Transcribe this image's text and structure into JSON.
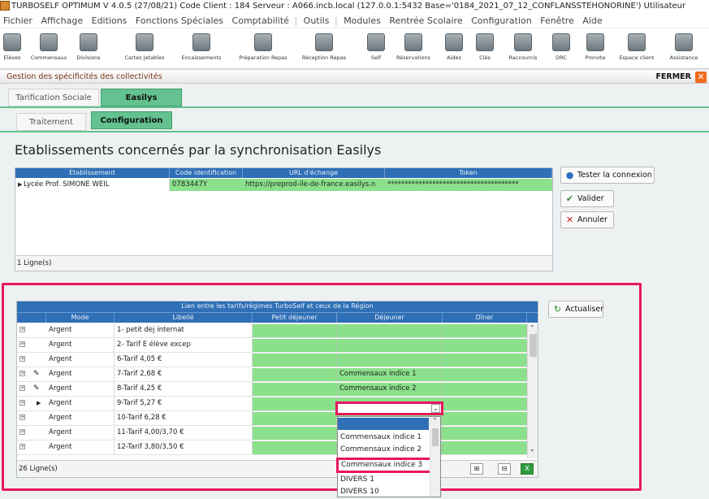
{
  "app": {
    "title": "TURBOSELF OPTIMUM  V 4.0.5 (27/08/21)  Code Client : 184  Serveur : A066.incb.local (127.0.0.1:5432 Base='0184_2021_07_12_CONFLANSSTEHONORINE')  Utilisateur"
  },
  "menu": [
    "Fichier",
    "Affichage",
    "Editions",
    "Fonctions Spéciales",
    "Comptabilité",
    "Outils",
    "Modules",
    "Rentrée Scolaire",
    "Configuration",
    "Fenêtre",
    "Aide"
  ],
  "toolbar": [
    {
      "label": "Elèves",
      "icon": "students-icon"
    },
    {
      "label": "Commensaux",
      "icon": "diners-icon"
    },
    {
      "label": "Divisions",
      "icon": "divisions-icon"
    },
    {
      "label": "Cartes Jetables",
      "icon": "cards-icon"
    },
    {
      "label": "Encaissements",
      "icon": "cashier-icon"
    },
    {
      "label": "Préparation Repas",
      "icon": "meal-prep-icon"
    },
    {
      "label": "Réception Repas",
      "icon": "meal-reception-icon"
    },
    {
      "label": "Self",
      "icon": "self-icon"
    },
    {
      "label": "Réservations",
      "icon": "reservations-icon"
    },
    {
      "label": "Aides",
      "icon": "aides-icon"
    },
    {
      "label": "Clés",
      "icon": "keys-icon"
    },
    {
      "label": "Raccourcis",
      "icon": "shortcuts-icon"
    },
    {
      "label": "DRC",
      "icon": "drc-icon"
    },
    {
      "label": "Pronote",
      "icon": "pronote-icon"
    },
    {
      "label": "Espace client",
      "icon": "client-space-icon"
    },
    {
      "label": "Assistance",
      "icon": "assistance-icon"
    }
  ],
  "window": {
    "title": "Gestion des spécificités des collectivités",
    "close_label": "FERMER",
    "tabs": [
      "Tarification Sociale",
      "Easilys"
    ],
    "subtabs": [
      "Traitement",
      "Configuration"
    ],
    "heading": "Etablissements concernés par la synchronisation Easilys"
  },
  "etab_grid": {
    "columns": [
      "Etablissement",
      "Code identification",
      "URL d'échange",
      "Token"
    ],
    "rows": [
      [
        "Lycée Prof. SIMONE WEIL",
        "0783447Y",
        "https://preprod-ile-de-france.easilys.n",
        "**************************************"
      ]
    ],
    "count": "1 Ligne(s)"
  },
  "side_buttons": {
    "test": "Tester la connexion",
    "validate": "Valider",
    "cancel": "Annuler",
    "refresh": "Actualiser"
  },
  "tarif_grid": {
    "title": "Lien entre les tarifs/régimes TurboSelf et ceux de la Région",
    "columns": [
      "Mode",
      "Libellé",
      "Petit déjeuner",
      "Déjeuner",
      "Dîner"
    ],
    "rows": [
      {
        "mode": "Argent",
        "label": "1- petit dej internat",
        "dej": ""
      },
      {
        "mode": "Argent",
        "label": "2- Tarif E élève excep",
        "dej": ""
      },
      {
        "mode": "Argent",
        "label": "6-Tarif 4,05 €",
        "dej": ""
      },
      {
        "mode": "Argent",
        "label": "7-Tarif 2,68 €",
        "dej": "Commensaux indice 1"
      },
      {
        "mode": "Argent",
        "label": "8-Tarif 4,25 €",
        "dej": "Commensaux indice 2"
      },
      {
        "mode": "Argent",
        "label": "9-Tarif 5,27 €",
        "dej": ""
      },
      {
        "mode": "Argent",
        "label": "10-Tarif 6,28 €",
        "dej": ""
      },
      {
        "mode": "Argent",
        "label": "11-Tarif 4,00/3,70 €",
        "dej": ""
      },
      {
        "mode": "Argent",
        "label": "12-Tarif 3,80/3,50 €",
        "dej": ""
      }
    ],
    "count": "26 Ligne(s)"
  },
  "dropdown": {
    "options": [
      "",
      "Commensaux indice 1",
      "Commensaux indice 2",
      "Commensaux indice 3",
      "DIVERS 1",
      "DIVERS 10"
    ]
  },
  "colors": {
    "header_blue": "#2f6fb6",
    "cell_green": "#8be08b",
    "tab_green": "#63c28f",
    "highlight": "#e8175e"
  }
}
